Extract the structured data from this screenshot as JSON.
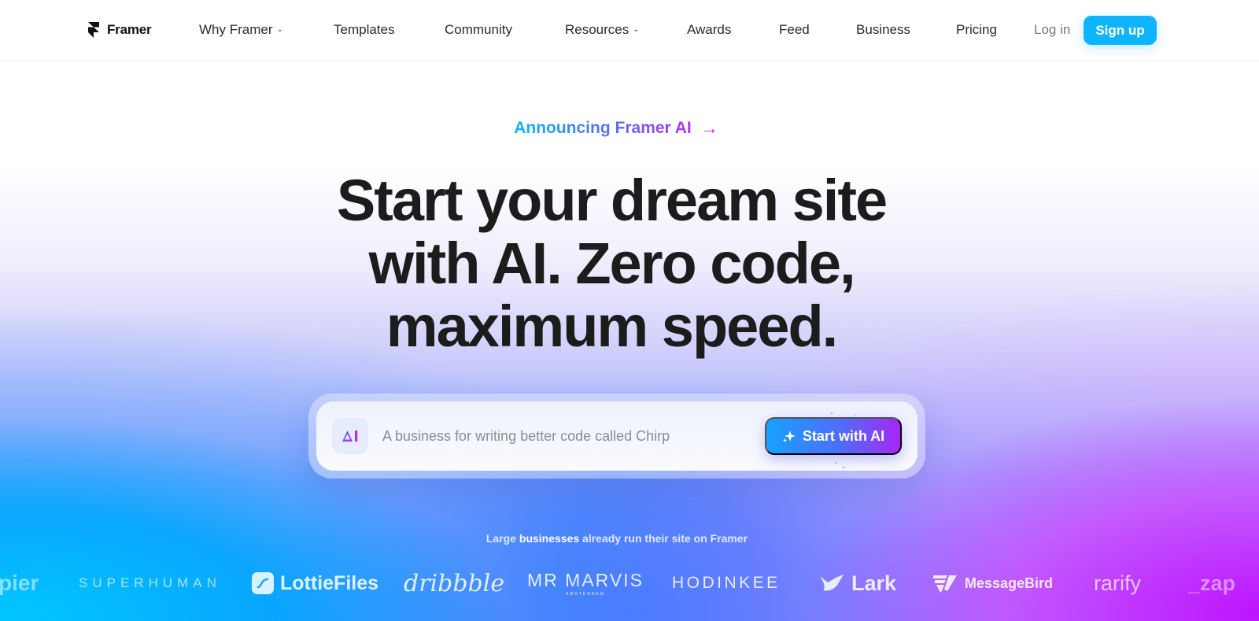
{
  "nav": {
    "brand": "Framer",
    "items": [
      {
        "label": "Why Framer",
        "has_dropdown": true
      },
      {
        "label": "Templates",
        "has_dropdown": false
      },
      {
        "label": "Community",
        "has_dropdown": false
      },
      {
        "label": "Resources",
        "has_dropdown": true
      },
      {
        "label": "Awards",
        "has_dropdown": false
      },
      {
        "label": "Feed",
        "has_dropdown": false
      },
      {
        "label": "Business",
        "has_dropdown": false
      },
      {
        "label": "Pricing",
        "has_dropdown": false
      }
    ],
    "login_label": "Log in",
    "signup_label": "Sign up",
    "dropdown_glyph": "⌄"
  },
  "hero": {
    "announcement": "Announcing Framer AI",
    "announcement_arrow": "→",
    "headline_lines": [
      "Start your dream site",
      "with AI. Zero code,",
      "maximum speed."
    ],
    "prompt": {
      "badge_icon": "ai-logo-icon",
      "placeholder": "A business for writing better code called Chirp",
      "value": "",
      "button_label": "Start with AI",
      "button_icon": "sparkle-icon"
    }
  },
  "social_proof": {
    "text_prefix": "Large",
    "text_bold": "businesses",
    "text_suffix": "already run their site on Framer",
    "logos": [
      {
        "name": "zapier",
        "label": "pier"
      },
      {
        "name": "superhuman",
        "label": "SUPERHUMAN"
      },
      {
        "name": "lottiefiles",
        "label": "LottieFiles"
      },
      {
        "name": "dribbble",
        "label": "dribbble"
      },
      {
        "name": "mr-marvis",
        "label": "MR MARVIS",
        "sublabel": "AMSTERDAM"
      },
      {
        "name": "hodinkee",
        "label": "HODINKEE"
      },
      {
        "name": "lark",
        "label": "Lark"
      },
      {
        "name": "messagebird",
        "label": "MessageBird"
      },
      {
        "name": "rarify",
        "label": "rarify"
      },
      {
        "name": "zapier",
        "label": "_zap"
      }
    ]
  },
  "colors": {
    "signup_bg": "#0fb4ff",
    "announce_gradient_start": "#0bb6f5",
    "announce_gradient_end": "#b233ec",
    "cta_gradient_start": "#16a2ff",
    "cta_gradient_end": "#a428f2",
    "headline": "#1c1c1c"
  }
}
